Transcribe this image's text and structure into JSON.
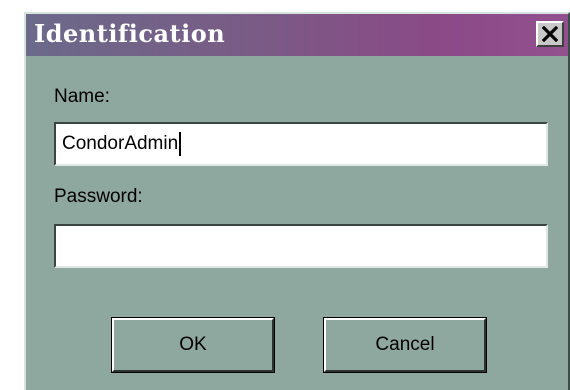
{
  "window": {
    "title": "Identification"
  },
  "form": {
    "name_label": "Name:",
    "name_value": "CondorAdmin",
    "password_label": "Password:",
    "password_value": ""
  },
  "buttons": {
    "ok_label": "OK",
    "cancel_label": "Cancel"
  },
  "icons": {
    "close": "close-icon"
  },
  "colors": {
    "dialog_bg": "#8fa89f",
    "titlebar_start": "#6b6a8a",
    "titlebar_end": "#93508f"
  }
}
